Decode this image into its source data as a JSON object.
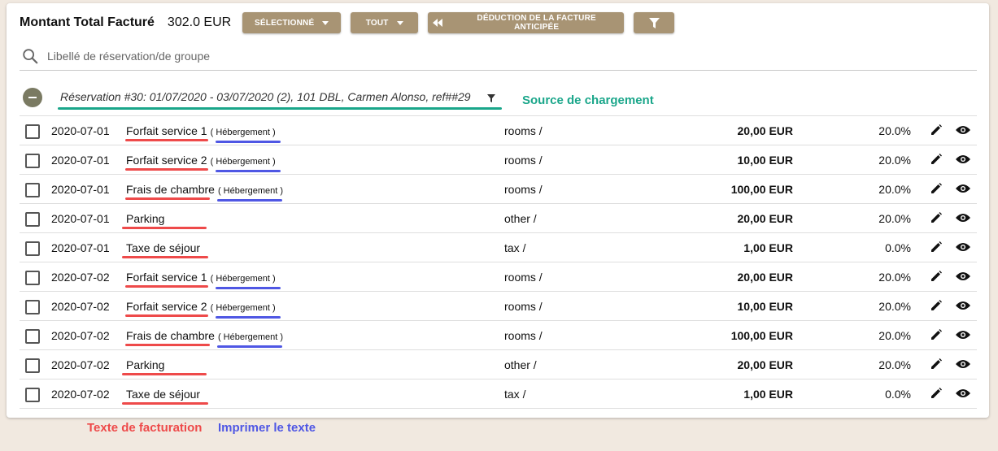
{
  "header": {
    "total_label": "Montant Total Facturé",
    "total_value": "302.0 EUR",
    "btn_selected": "SÉLECTIONNÉ",
    "btn_all": "TOUT",
    "btn_deduct": "DÉDUCTION DE LA FACTURE ANTICIPÉE",
    "btn_filter_icon": "filter-icon"
  },
  "search": {
    "placeholder": "Libellé de réservation/de groupe"
  },
  "group": {
    "label": "Réservation #30: 01/07/2020 - 03/07/2020 (2), 101 DBL, Carmen Alonso, ref##29"
  },
  "annotations": {
    "source": "Source de chargement",
    "billing_text": "Texte de facturation",
    "print_text": "Imprimer le texte"
  },
  "colors": {
    "button": "#a89474",
    "annotation_green": "#1aa68a",
    "annotation_red": "#ee4a4a",
    "annotation_blue": "#4f57e4"
  },
  "rows": [
    {
      "date": "2020-07-01",
      "desc": "Forfait service 1",
      "tag": "( Hébergement )",
      "category": "rooms /",
      "amount": "20,00 EUR",
      "vat": "20.0%"
    },
    {
      "date": "2020-07-01",
      "desc": "Forfait service 2",
      "tag": "( Hébergement )",
      "category": "rooms /",
      "amount": "10,00 EUR",
      "vat": "20.0%"
    },
    {
      "date": "2020-07-01",
      "desc": "Frais de chambre",
      "tag": "( Hébergement )",
      "category": "rooms /",
      "amount": "100,00 EUR",
      "vat": "20.0%"
    },
    {
      "date": "2020-07-01",
      "desc": "Parking",
      "tag": "",
      "category": "other /",
      "amount": "20,00 EUR",
      "vat": "20.0%"
    },
    {
      "date": "2020-07-01",
      "desc": "Taxe de séjour",
      "tag": "",
      "category": "tax /",
      "amount": "1,00 EUR",
      "vat": "0.0%"
    },
    {
      "date": "2020-07-02",
      "desc": "Forfait service 1",
      "tag": "( Hébergement )",
      "category": "rooms /",
      "amount": "20,00 EUR",
      "vat": "20.0%"
    },
    {
      "date": "2020-07-02",
      "desc": "Forfait service 2",
      "tag": "( Hébergement )",
      "category": "rooms /",
      "amount": "10,00 EUR",
      "vat": "20.0%"
    },
    {
      "date": "2020-07-02",
      "desc": "Frais de chambre",
      "tag": "( Hébergement )",
      "category": "rooms /",
      "amount": "100,00 EUR",
      "vat": "20.0%"
    },
    {
      "date": "2020-07-02",
      "desc": "Parking",
      "tag": "",
      "category": "other /",
      "amount": "20,00 EUR",
      "vat": "20.0%"
    },
    {
      "date": "2020-07-02",
      "desc": "Taxe de séjour",
      "tag": "",
      "category": "tax /",
      "amount": "1,00 EUR",
      "vat": "0.0%"
    }
  ]
}
